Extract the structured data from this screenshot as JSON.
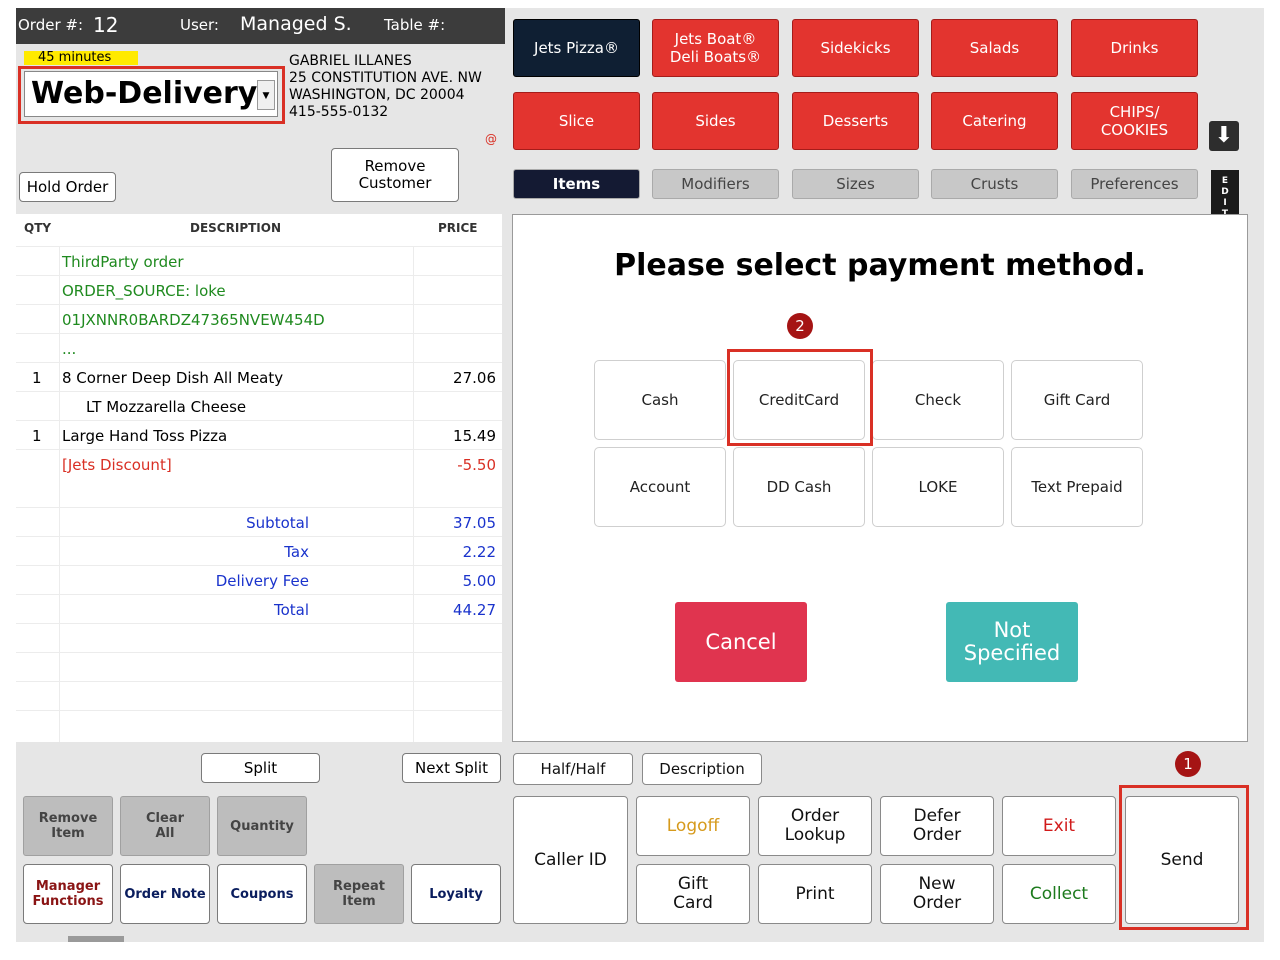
{
  "header": {
    "order_label": "Order #:",
    "order_number": "12",
    "user_label": "User:",
    "user_name": "Managed S.",
    "table_label": "Table #:"
  },
  "order_type": {
    "eta": "45 minutes",
    "selected": "Web-Delivery"
  },
  "customer": {
    "name": "GABRIEL ILLANES",
    "street": "25 CONSTITUTION AVE. NW",
    "city": "WASHINGTON, DC 20004",
    "phone": "415-555-0132",
    "at_symbol": "@"
  },
  "buttons": {
    "hold_order": "Hold Order",
    "remove_customer": "Remove\nCustomer",
    "split": "Split",
    "next_split": "Next Split"
  },
  "order_table": {
    "headers": {
      "qty": "QTY",
      "description": "DESCRIPTION",
      "price": "PRICE"
    },
    "rows": [
      {
        "qty": "",
        "desc": "ThirdParty order",
        "price": "",
        "color": "#1f8a1f"
      },
      {
        "qty": "",
        "desc": "ORDER_SOURCE: loke",
        "price": "",
        "color": "#1f8a1f"
      },
      {
        "qty": "",
        "desc": "01JXNNR0BARDZ47365NVEW454D",
        "price": "",
        "color": "#1f8a1f"
      },
      {
        "qty": "",
        "desc": "...",
        "price": "",
        "color": "#1f8a1f"
      },
      {
        "qty": "1",
        "desc": "8 Corner Deep Dish All Meaty",
        "price": "27.06",
        "color": "#000000"
      },
      {
        "qty": "",
        "desc": "LT Mozzarella Cheese",
        "price": "",
        "color": "#000000"
      },
      {
        "qty": "1",
        "desc": "Large Hand Toss Pizza",
        "price": "15.49",
        "color": "#000000"
      },
      {
        "qty": "",
        "desc": "[Jets Discount]",
        "price": "-5.50",
        "color": "#d93025"
      }
    ],
    "totals": [
      {
        "label": "Subtotal",
        "value": "37.05"
      },
      {
        "label": "Tax",
        "value": "2.22"
      },
      {
        "label": "Delivery Fee",
        "value": "5.00"
      },
      {
        "label": "Total",
        "value": "44.27"
      }
    ]
  },
  "categories": {
    "row1": [
      "Jets Pizza®",
      "Jets Boat®\nDeli Boats®",
      "Sidekicks",
      "Salads",
      "Drinks"
    ],
    "row2": [
      "Slice",
      "Sides",
      "Desserts",
      "Catering",
      "CHIPS/\nCOOKIES"
    ]
  },
  "tabs": [
    "Items",
    "Modifiers",
    "Sizes",
    "Crusts",
    "Preferences"
  ],
  "edit_tab": "E\nD\nI\nT",
  "payment": {
    "title": "Please select payment method.",
    "methods": [
      "Cash",
      "CreditCard",
      "Check",
      "Gift Card",
      "Account",
      "DD Cash",
      "LOKE",
      "Text Prepaid"
    ],
    "cancel": "Cancel",
    "not_specified": "Not\nSpecified",
    "step_badge": "2"
  },
  "left_actions": {
    "remove_item": "Remove\nItem",
    "clear_all": "Clear\nAll",
    "quantity": "Quantity",
    "manager_functions": "Manager\nFunctions",
    "order_note": "Order Note",
    "coupons": "Coupons",
    "repeat_item": "Repeat\nItem",
    "loyalty": "Loyalty"
  },
  "right_actions": {
    "half_half": "Half/Half",
    "description": "Description",
    "caller_id": "Caller ID",
    "logoff": "Logoff",
    "order_lookup": "Order\nLookup",
    "defer_order": "Defer\nOrder",
    "exit": "Exit",
    "gift_card": "Gift\nCard",
    "print": "Print",
    "new_order": "New\nOrder",
    "collect": "Collect",
    "send": "Send",
    "step_badge": "1"
  },
  "colors": {
    "accent_red": "#e3342f",
    "highlight_red": "#d93025",
    "total_blue": "#1a33cc",
    "teal": "#43b9b5",
    "cancel_pink": "#e0344f"
  }
}
